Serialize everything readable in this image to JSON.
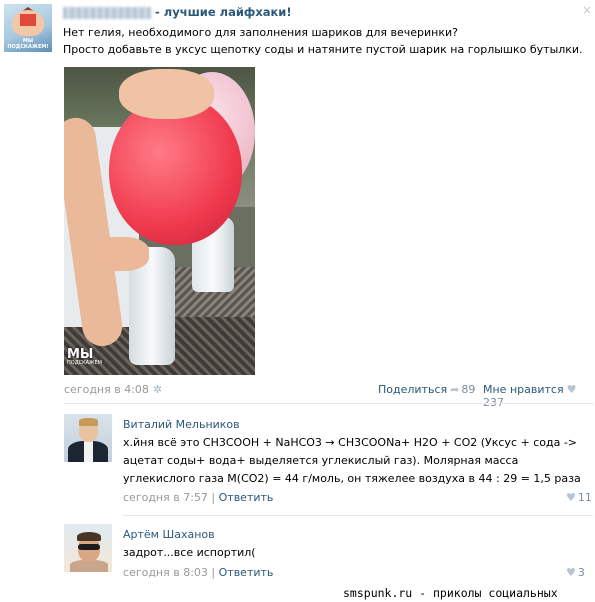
{
  "post": {
    "group_name_suffix": " - лучшие лайфхаки!",
    "text_line1": "Нет гелия, необходимого для заполнения шариков для вечеринки?",
    "text_line2": "Просто добавьте в уксус щепотку соды и натяните пустой шарик на горлышко бутылки.",
    "avatar_caption": "МЫ ПОДСКАЖЕМ!",
    "close_symbol": "×",
    "photo_watermark": "МЫ",
    "photo_watermark_sub": "ПОДСКАЖЕМ",
    "date": "сегодня в 4:08",
    "share_label": "Поделиться",
    "share_count": "89",
    "like_label": "Мне нравится",
    "like_count": "237"
  },
  "comments": [
    {
      "name": "Виталий Мельников",
      "text": "х.йня всё это CH3COOH + NaHCO3 → CH3COONa+ H2O + CO2 (Уксус + сода -> ацетат соды+ вода+ выделяется углекислый газ). Молярная масса углекислого газа M(CO2) = 44 г/моль, он тяжелее воздуха в 44 : 29 = 1,5 раза",
      "date": "сегодня в 7:57",
      "reply_label": "Ответить",
      "likes": "11"
    },
    {
      "name": "Артём Шаханов",
      "text": "задрот...все испортил(",
      "date": "сегодня в 8:03",
      "reply_label": "Ответить",
      "likes": "3"
    }
  ],
  "footer": {
    "credit": "smspunk.ru - приколы социальных сетей"
  },
  "icons": {
    "settings": "gear-icon",
    "share": "share-arrow-icon",
    "like": "heart-icon",
    "close": "close-icon"
  },
  "colors": {
    "link": "#2b587a",
    "muted": "#999999",
    "counter": "#7c8ea0"
  }
}
